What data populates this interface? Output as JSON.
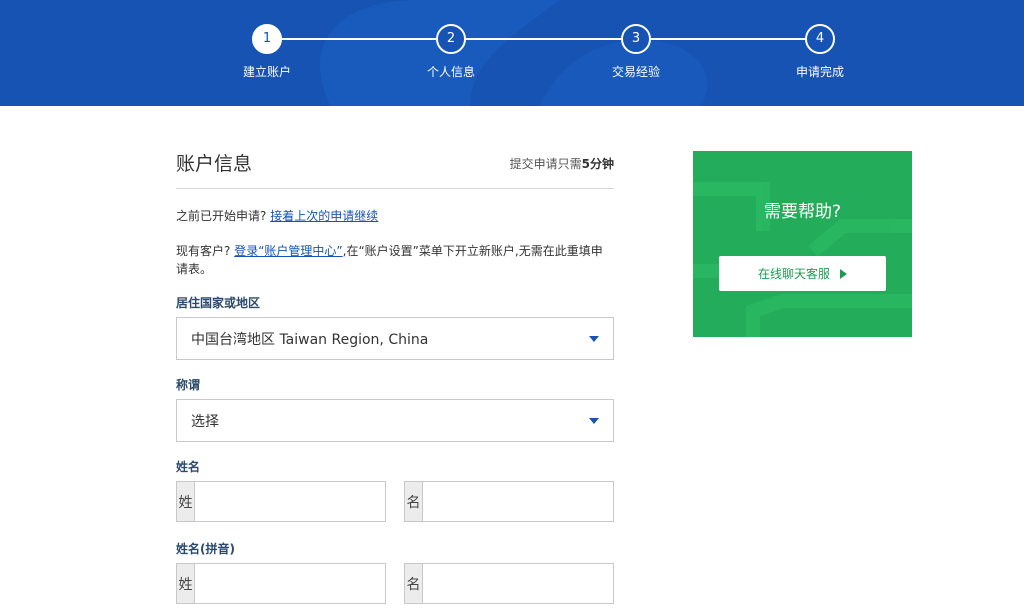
{
  "stepper": {
    "steps": [
      {
        "number": "1",
        "label": "建立账户",
        "active": true
      },
      {
        "number": "2",
        "label": "个人信息",
        "active": false
      },
      {
        "number": "3",
        "label": "交易经验",
        "active": false
      },
      {
        "number": "4",
        "label": "申请完成",
        "active": false
      }
    ]
  },
  "form": {
    "title": "账户信息",
    "time_note_prefix": "提交申请只需",
    "time_note_value": "5分钟",
    "resume_text": "之前已开始申请? ",
    "resume_link": "接着上次的申请继续",
    "existing_text_1": "现有客户? ",
    "existing_link": "登录“账户管理中心”",
    "existing_text_2": ",在“账户设置”菜单下开立新账户,无需在此重填申请表。",
    "country_label": "居住国家或地区",
    "country_value": "中国台湾地区 Taiwan Region, China",
    "salutation_label": "称谓",
    "salutation_value": "选择",
    "name_label": "姓名",
    "pinyin_label": "姓名(拼音)",
    "surname_addon": "姓",
    "given_addon": "名"
  },
  "help": {
    "title": "需要帮助?",
    "button_label": "在线聊天客服"
  },
  "colors": {
    "header_blue": "#1653b2",
    "help_green": "#23ad5a"
  }
}
